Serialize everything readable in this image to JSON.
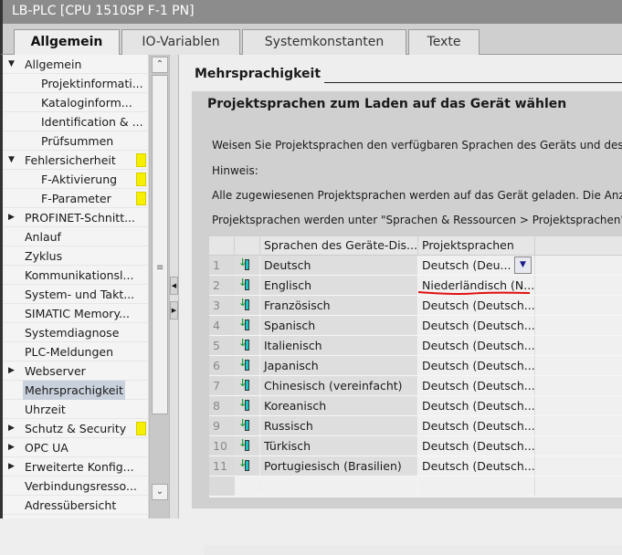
{
  "window": {
    "title": "LB-PLC [CPU 1510SP F-1 PN]"
  },
  "tabs": [
    {
      "label": "Allgemein",
      "active": true
    },
    {
      "label": "IO-Variablen"
    },
    {
      "label": "Systemkonstanten"
    },
    {
      "label": "Texte"
    }
  ],
  "tree": [
    {
      "label": "Allgemein",
      "level": 0,
      "expander": "expanded"
    },
    {
      "label": "Projektinformati...",
      "level": 1
    },
    {
      "label": "Kataloginform...",
      "level": 1
    },
    {
      "label": "Identification & ...",
      "level": 1
    },
    {
      "label": "Prüfsummen",
      "level": 1
    },
    {
      "label": "Fehlersicherheit",
      "level": 0,
      "expander": "expanded",
      "marker": true
    },
    {
      "label": "F-Aktivierung",
      "level": 1,
      "marker": true
    },
    {
      "label": "F-Parameter",
      "level": 1,
      "marker": true
    },
    {
      "label": "PROFINET-Schnitt...",
      "level": 0,
      "expander": "collapsed"
    },
    {
      "label": "Anlauf",
      "level": 0
    },
    {
      "label": "Zyklus",
      "level": 0
    },
    {
      "label": "Kommunikationsl...",
      "level": 0
    },
    {
      "label": "System- und Takt...",
      "level": 0
    },
    {
      "label": "SIMATIC Memory...",
      "level": 0
    },
    {
      "label": "Systemdiagnose",
      "level": 0
    },
    {
      "label": "PLC-Meldungen",
      "level": 0
    },
    {
      "label": "Webserver",
      "level": 0,
      "expander": "collapsed"
    },
    {
      "label": "Mehrsprachigkeit",
      "level": 0,
      "selected": true
    },
    {
      "label": "Uhrzeit",
      "level": 0
    },
    {
      "label": "Schutz & Security",
      "level": 0,
      "expander": "collapsed",
      "marker": true
    },
    {
      "label": "OPC UA",
      "level": 0,
      "expander": "collapsed"
    },
    {
      "label": "Erweiterte Konfig...",
      "level": 0,
      "expander": "collapsed"
    },
    {
      "label": "Verbindungsresso...",
      "level": 0
    },
    {
      "label": "Adressübersicht",
      "level": 0
    }
  ],
  "content": {
    "section_title": "Mehrsprachigkeit",
    "box_title": "Projektsprachen zum Laden auf das Gerät wählen",
    "paragraphs": [
      "Weisen Sie Projektsprachen den verfügbaren Sprachen des Geräts und des W",
      "Hinweis:",
      "Alle zugewiesenen Projektsprachen werden auf das Gerät geladen. Die Anzah",
      "Projektsprachen werden unter \"Sprachen & Ressourcen > Projektsprachen\" ko"
    ],
    "table": {
      "headers": [
        "",
        "",
        "Sprachen des Geräte-Dis...",
        "Projektsprachen"
      ],
      "rows": [
        {
          "num": "1",
          "lang": "Deutsch",
          "proj": "Deutsch (Deu...",
          "dropdown": true
        },
        {
          "num": "2",
          "lang": "Englisch",
          "proj": "Niederländisch (N...",
          "underlined": true
        },
        {
          "num": "3",
          "lang": "Französisch",
          "proj": "Deutsch (Deutsch..."
        },
        {
          "num": "4",
          "lang": "Spanisch",
          "proj": "Deutsch (Deutsch..."
        },
        {
          "num": "5",
          "lang": "Italienisch",
          "proj": "Deutsch (Deutsch..."
        },
        {
          "num": "6",
          "lang": "Japanisch",
          "proj": "Deutsch (Deutsch..."
        },
        {
          "num": "7",
          "lang": "Chinesisch (vereinfacht)",
          "proj": "Deutsch (Deutsch..."
        },
        {
          "num": "8",
          "lang": "Koreanisch",
          "proj": "Deutsch (Deutsch..."
        },
        {
          "num": "9",
          "lang": "Russisch",
          "proj": "Deutsch (Deutsch..."
        },
        {
          "num": "10",
          "lang": "Türkisch",
          "proj": "Deutsch (Deutsch..."
        },
        {
          "num": "11",
          "lang": "Portugiesisch (Brasilien)",
          "proj": "Deutsch (Deutsch..."
        }
      ]
    }
  },
  "colors": {
    "marker": "#f7ef00",
    "annotation": "#e01010",
    "selected": "#c9d1dc"
  }
}
